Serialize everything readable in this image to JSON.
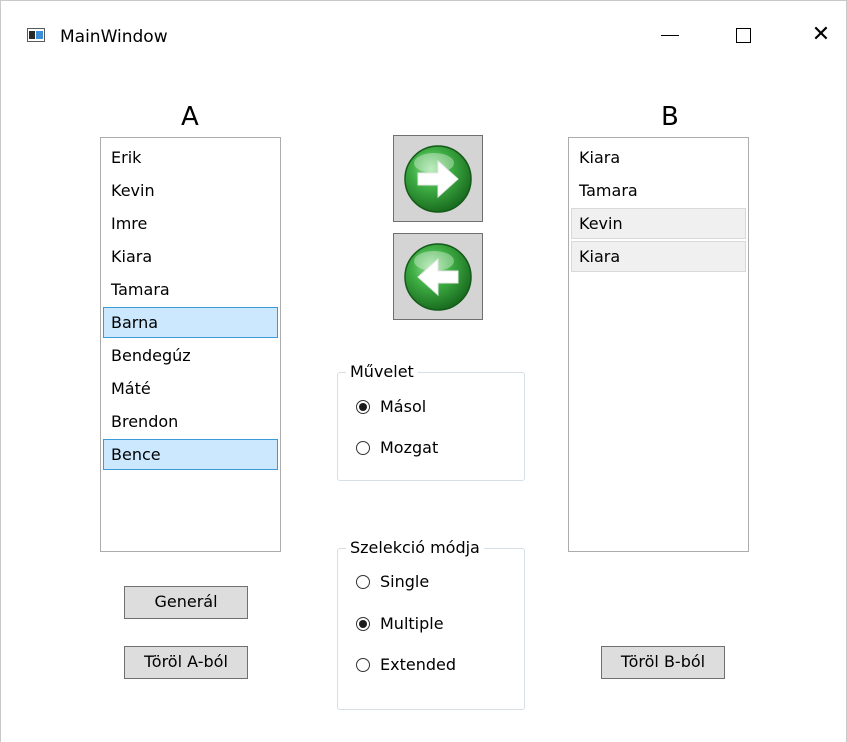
{
  "window": {
    "title": "MainWindow",
    "minimize_icon": "minimize-icon",
    "maximize_icon": "maximize-icon",
    "close_glyph": "✕"
  },
  "list_a": {
    "header": "A",
    "items": [
      {
        "label": "Erik",
        "selected": false
      },
      {
        "label": "Kevin",
        "selected": false
      },
      {
        "label": "Imre",
        "selected": false
      },
      {
        "label": "Kiara",
        "selected": false
      },
      {
        "label": "Tamara",
        "selected": false
      },
      {
        "label": "Barna",
        "selected": true
      },
      {
        "label": "Bendegúz",
        "selected": false
      },
      {
        "label": "Máté",
        "selected": false
      },
      {
        "label": "Brendon",
        "selected": false
      },
      {
        "label": "Bence",
        "selected": true
      }
    ]
  },
  "list_b": {
    "header": "B",
    "items": [
      {
        "label": "Kiara",
        "highlight": false
      },
      {
        "label": "Tamara",
        "highlight": false
      },
      {
        "label": "Kevin",
        "highlight": true
      },
      {
        "label": "Kiara",
        "highlight": true
      }
    ]
  },
  "transfer": {
    "right_icon": "arrow-right-icon",
    "left_icon": "arrow-left-icon",
    "accent": "#2f9a34"
  },
  "operation": {
    "title": "Művelet",
    "options": [
      {
        "label": "Másol",
        "checked": true
      },
      {
        "label": "Mozgat",
        "checked": false
      }
    ]
  },
  "selection_mode": {
    "title": "Szelekció módja",
    "options": [
      {
        "label": "Single",
        "checked": false
      },
      {
        "label": "Multiple",
        "checked": true
      },
      {
        "label": "Extended",
        "checked": false
      }
    ]
  },
  "buttons": {
    "generate": "Generál",
    "clear_a": "Töröl A-ból",
    "clear_b": "Töröl B-ból"
  },
  "colors": {
    "selection_bg": "#cce8ff",
    "selection_border": "#3d9ad9"
  }
}
